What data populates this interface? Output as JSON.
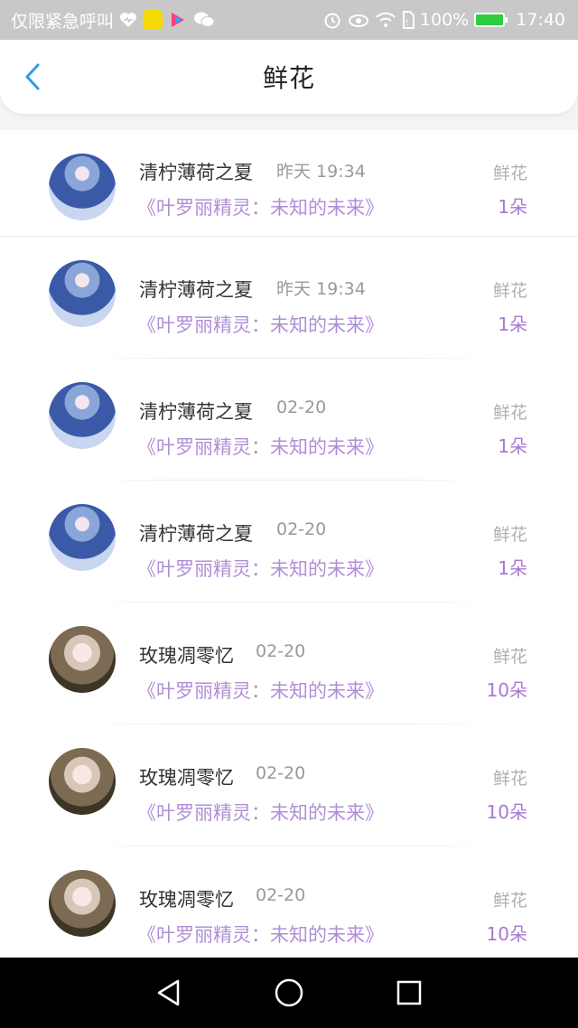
{
  "status_bar": {
    "carrier": "仅限紧急呼叫",
    "battery": "100%",
    "time": "17:40",
    "icons": [
      "heart-icon",
      "app-icon",
      "youku-icon",
      "wechat-icon",
      "alarm-icon",
      "eye-icon",
      "wifi-icon",
      "sim-icon",
      "battery-icon"
    ]
  },
  "header": {
    "title": "鲜花",
    "back_icon": "chevron-left-icon"
  },
  "items": [
    {
      "name": "清柠薄荷之夏",
      "time": "昨天 19:34",
      "book": "《叶罗丽精灵：未知的未来》",
      "type": "鲜花",
      "count": "1朵",
      "avatar": "blue"
    },
    {
      "name": "清柠薄荷之夏",
      "time": "昨天 19:34",
      "book": "《叶罗丽精灵：未知的未来》",
      "type": "鲜花",
      "count": "1朵",
      "avatar": "blue"
    },
    {
      "name": "清柠薄荷之夏",
      "time": "02-20",
      "book": "《叶罗丽精灵：未知的未来》",
      "type": "鲜花",
      "count": "1朵",
      "avatar": "blue"
    },
    {
      "name": "清柠薄荷之夏",
      "time": "02-20",
      "book": "《叶罗丽精灵：未知的未来》",
      "type": "鲜花",
      "count": "1朵",
      "avatar": "blue"
    },
    {
      "name": "玫瑰凋零忆",
      "time": "02-20",
      "book": "《叶罗丽精灵：未知的未来》",
      "type": "鲜花",
      "count": "10朵",
      "avatar": "rose"
    },
    {
      "name": "玫瑰凋零忆",
      "time": "02-20",
      "book": "《叶罗丽精灵：未知的未来》",
      "type": "鲜花",
      "count": "10朵",
      "avatar": "rose"
    },
    {
      "name": "玫瑰凋零忆",
      "time": "02-20",
      "book": "《叶罗丽精灵：未知的未来》",
      "type": "鲜花",
      "count": "10朵",
      "avatar": "rose"
    }
  ],
  "colors": {
    "accent_purple": "#a978d2",
    "book_purple": "#b08fd6",
    "back_blue": "#2f9be8"
  },
  "nav": {
    "icons": [
      "back-triangle-icon",
      "home-circle-icon",
      "recents-square-icon"
    ]
  }
}
